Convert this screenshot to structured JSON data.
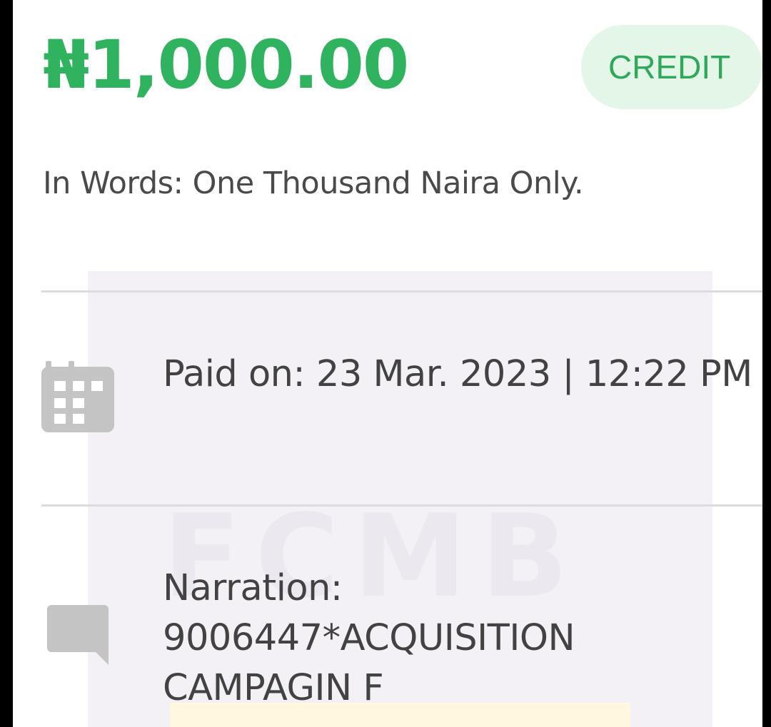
{
  "transaction": {
    "amount": "₦1,000.00",
    "type_badge": "CREDIT",
    "in_words": "In Words: One Thousand Naira  Only."
  },
  "details": {
    "paid_on": "Paid on: 23 Mar. 2023 | 12:22 PM",
    "narration_label": "Narration:",
    "narration_line1": "9006447*ACQUISITION",
    "narration_line2": "CAMPAGIN F"
  },
  "watermark": {
    "text": "FCMB"
  },
  "icons": {
    "paid_on": "calendar-icon",
    "narration": "message-icon"
  },
  "colors": {
    "amount": "#2fb35f",
    "badge_bg": "#e4f6e7",
    "badge_text": "#2ea85a",
    "icon": "#c4c4c4"
  }
}
